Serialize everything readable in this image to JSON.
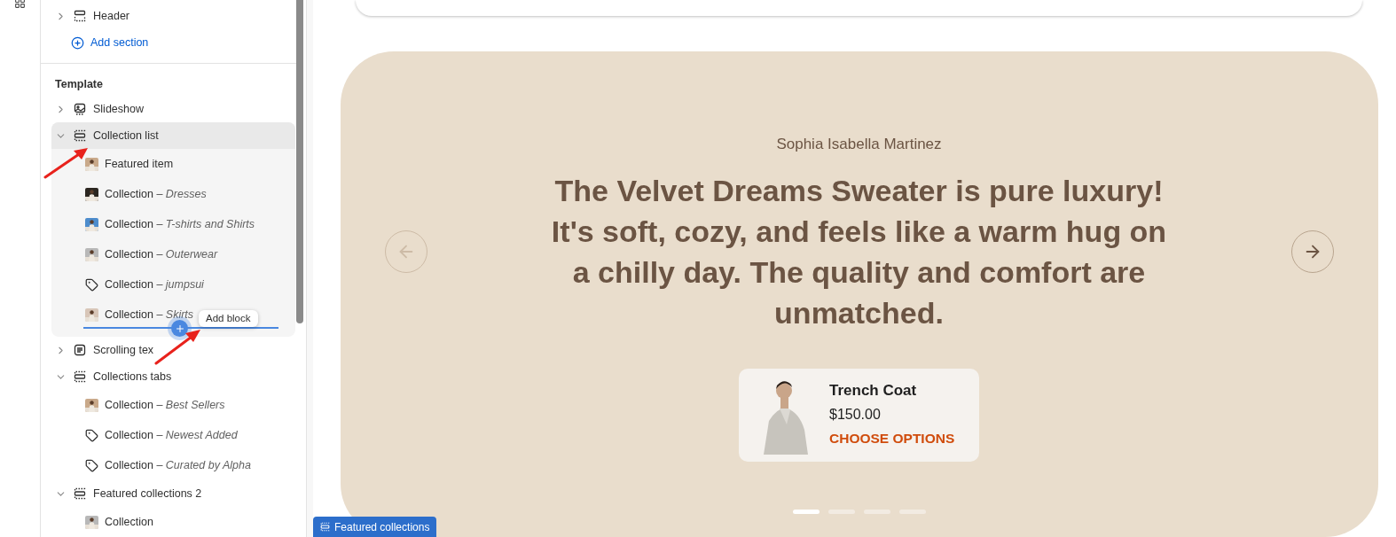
{
  "sidebar": {
    "top_sections": [
      {
        "label": "Header",
        "kind": "header",
        "expanded": false
      }
    ],
    "add_section": "Add section",
    "group_title": "Template",
    "sections": [
      {
        "label": "Slideshow",
        "kind": "slideshow",
        "expanded": false,
        "selected": false
      },
      {
        "label": "Collection list",
        "kind": "collection",
        "expanded": true,
        "selected": true,
        "children": [
          {
            "label": "Featured item",
            "kind": "picture"
          },
          {
            "label": "Collection",
            "detail": "– Dresses",
            "kind": "picture"
          },
          {
            "label": "Collection",
            "detail": "– T-shirts and Shirts",
            "kind": "picture"
          },
          {
            "label": "Collection",
            "detail": "– Outerwear",
            "kind": "picture"
          },
          {
            "label": "Collection",
            "detail": "– jumpsui",
            "kind": "tag"
          },
          {
            "label": "Collection",
            "detail": "– Skirts",
            "kind": "picture"
          }
        ]
      },
      {
        "label": "Scrolling tex",
        "kind": "text",
        "expanded": false,
        "selected": false
      },
      {
        "label": "Collections tabs",
        "kind": "collection",
        "expanded": true,
        "selected": false,
        "children": [
          {
            "label": "Collection",
            "detail": "– Best Sellers",
            "kind": "picture"
          },
          {
            "label": "Collection",
            "detail": "– Newest Added",
            "kind": "tag"
          },
          {
            "label": "Collection",
            "detail": "– Curated by Alpha",
            "kind": "tag"
          }
        ]
      },
      {
        "label": "Featured collections 2",
        "kind": "collection",
        "expanded": true,
        "selected": false,
        "children": [
          {
            "label": "Collection",
            "kind": "picture"
          }
        ]
      }
    ],
    "tooltip": "Add block"
  },
  "preview": {
    "author": "Sophia Isabella Martinez",
    "quote": "The Velvet Dreams Sweater is pure luxury! It's soft, cozy, and feels like a warm hug on a chilly day. The quality and comfort are unmatched.",
    "product": {
      "name": "Trench Coat",
      "price": "$150.00",
      "action": "CHOOSE OPTIONS"
    },
    "dots": [
      {
        "selected": true
      },
      {
        "selected": false
      },
      {
        "selected": false
      },
      {
        "selected": false
      }
    ],
    "section_tag": "Featured collections"
  }
}
